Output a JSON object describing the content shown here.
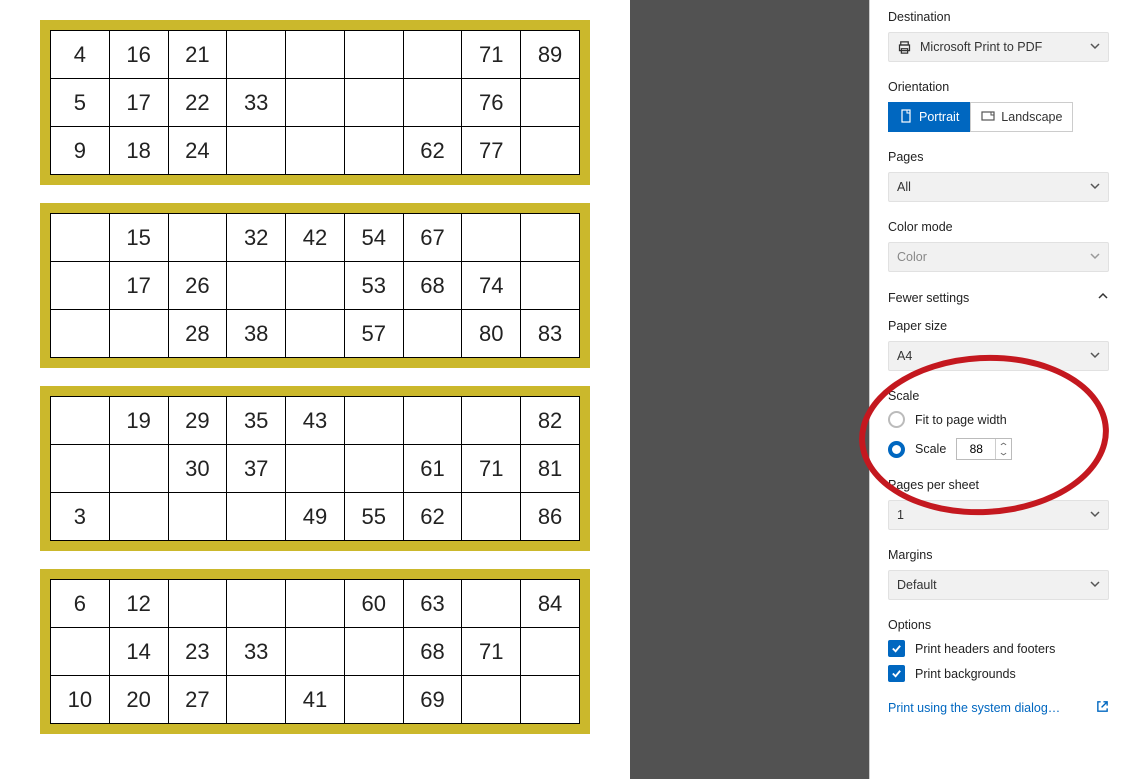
{
  "cards": [
    [
      [
        "4",
        "16",
        "21",
        "",
        "",
        "",
        "",
        "71",
        "89"
      ],
      [
        "5",
        "17",
        "22",
        "33",
        "",
        "",
        "",
        "76",
        ""
      ],
      [
        "9",
        "18",
        "24",
        "",
        "",
        "",
        "62",
        "77",
        ""
      ]
    ],
    [
      [
        "",
        "15",
        "",
        "32",
        "42",
        "54",
        "67",
        "",
        ""
      ],
      [
        "",
        "17",
        "26",
        "",
        "",
        "53",
        "68",
        "74",
        ""
      ],
      [
        "",
        "",
        "28",
        "38",
        "",
        "57",
        "",
        "80",
        "83"
      ]
    ],
    [
      [
        "",
        "19",
        "29",
        "35",
        "43",
        "",
        "",
        "",
        "82"
      ],
      [
        "",
        "",
        "30",
        "37",
        "",
        "",
        "61",
        "71",
        "81"
      ],
      [
        "3",
        "",
        "",
        "",
        "49",
        "55",
        "62",
        "",
        "86"
      ]
    ],
    [
      [
        "6",
        "12",
        "",
        "",
        "",
        "60",
        "63",
        "",
        "84"
      ],
      [
        "",
        "14",
        "23",
        "33",
        "",
        "",
        "68",
        "71",
        ""
      ],
      [
        "10",
        "20",
        "27",
        "",
        "41",
        "",
        "69",
        "",
        ""
      ]
    ]
  ],
  "panel": {
    "destination_label": "Destination",
    "destination_value": "Microsoft Print to PDF",
    "orientation_label": "Orientation",
    "portrait": "Portrait",
    "landscape": "Landscape",
    "pages_label": "Pages",
    "pages_value": "All",
    "colormode_label": "Color mode",
    "colormode_value": "Color",
    "fewer_settings": "Fewer settings",
    "papersize_label": "Paper size",
    "papersize_value": "A4",
    "scale_label": "Scale",
    "fit_label": "Fit to page width",
    "scale_radio_label": "Scale",
    "scale_value": "88",
    "pps_label": "Pages per sheet",
    "pps_value": "1",
    "margins_label": "Margins",
    "margins_value": "Default",
    "options_label": "Options",
    "opt_headers": "Print headers and footers",
    "opt_backgrounds": "Print backgrounds",
    "sys_dialog": "Print using the system dialog…"
  }
}
